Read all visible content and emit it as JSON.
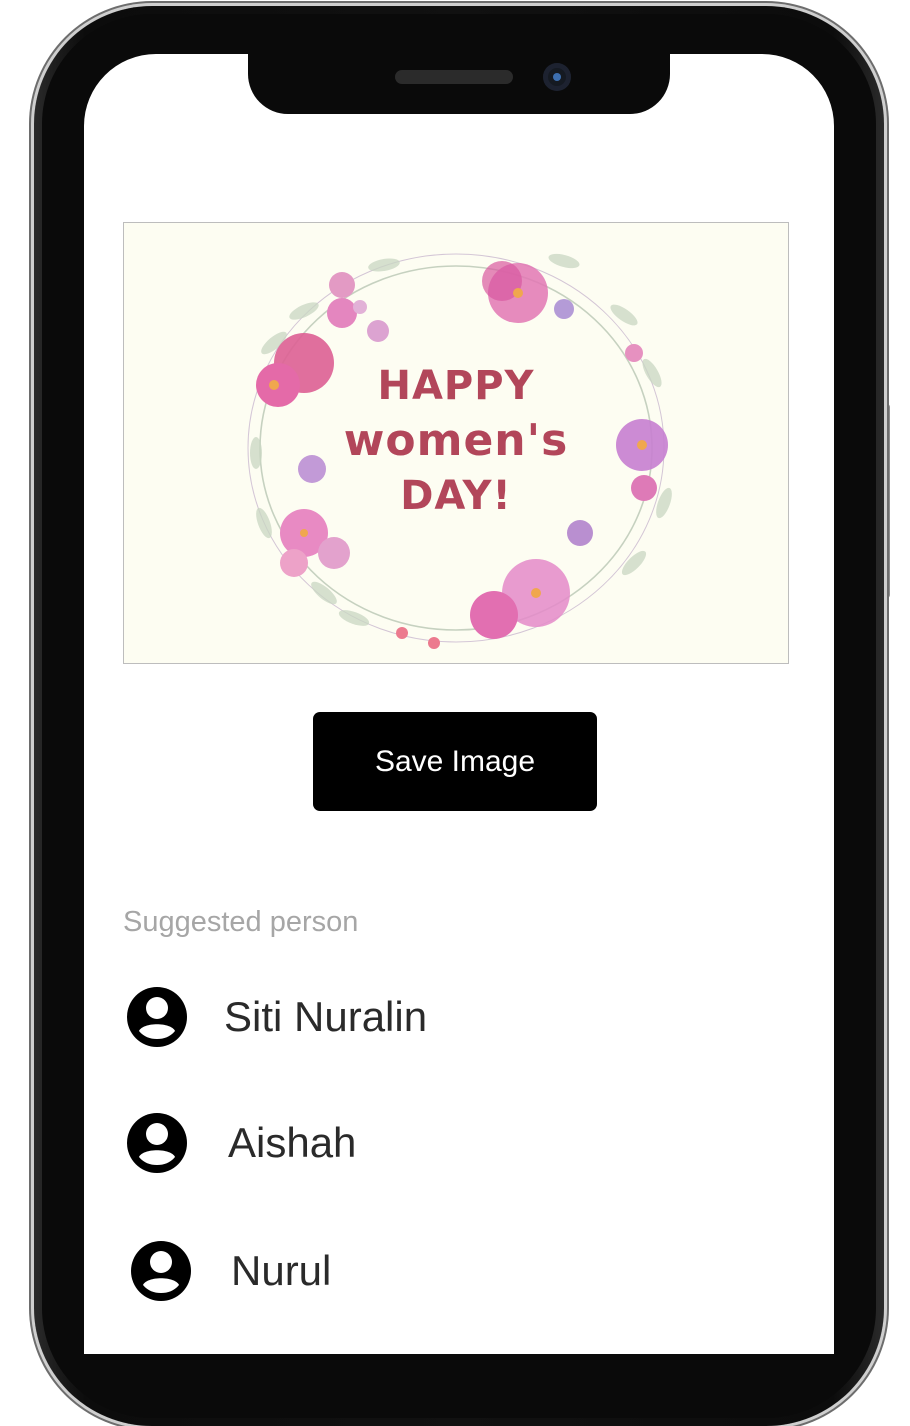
{
  "card": {
    "title_line1": "HAPPY",
    "title_line2": "women's",
    "title_line3": "DAY!",
    "text_color": "#b2465a",
    "background": "#fdfdf2"
  },
  "actions": {
    "save_label": "Save Image"
  },
  "suggested": {
    "heading": "Suggested person",
    "people": [
      {
        "name": "Siti Nuralin",
        "icon": "account-circle-icon"
      },
      {
        "name": "Aishah",
        "icon": "account-circle-icon"
      },
      {
        "name": "Nurul",
        "icon": "account-circle-icon"
      }
    ]
  }
}
